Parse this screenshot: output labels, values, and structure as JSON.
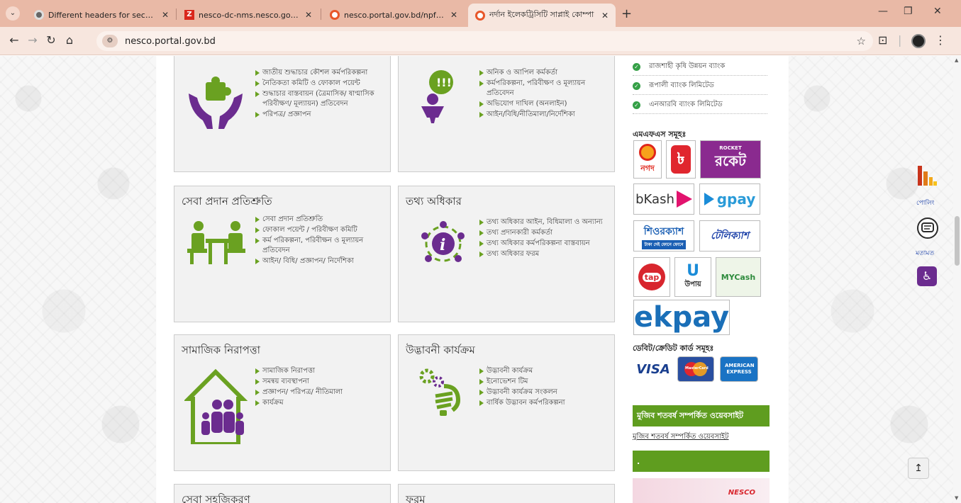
{
  "browser": {
    "tabs": [
      {
        "title": "Different headers for sections",
        "icon": "gear-favicon"
      },
      {
        "title": "nesco-dc-nms.nesco.gov.bd: H",
        "icon": "z-favicon"
      },
      {
        "title": "nesco.portal.gov.bd/npfadmin/",
        "icon": "portal-favicon"
      },
      {
        "title": "নর্দান ইলেকট্রিসিটি সাপ্লাই কোম্পা",
        "icon": "portal-favicon"
      }
    ],
    "url": "nesco.portal.gov.bd"
  },
  "cards": [
    {
      "title": "",
      "icon": "hands-puzzle-icon",
      "items": [
        "জাতীয় শুদ্ধাচার কৌশল কর্মপরিকল্পনা",
        "নৈতিকতা কমিটি ও ফোকাল পয়েন্ট",
        "শুদ্ধাচার বাস্তবায়ন (ত্রৈমাসিক/ ষাণ্মাসিক পরিবীক্ষণ/ মূল্যায়ন) প্রতিবেদন",
        "পরিপত্র/ প্রজ্ঞাপন"
      ]
    },
    {
      "title": "",
      "icon": "speech-person-icon",
      "items": [
        "অনিক ও আপিল কর্মকর্তা",
        "কর্মপরিকল্পনা, পরিবীক্ষণ ও মূল্যায়ন প্রতিবেদন",
        "অভিযোগ দাখিল (অনলাইন)",
        "আইন/বিধি/নীতিমালা/নির্দেশিকা"
      ]
    },
    {
      "title": "সেবা প্রদান প্রতিশ্রুতি",
      "icon": "service-desk-icon",
      "items": [
        "সেবা প্রদান প্রতিশ্রুতি",
        "ফোকাল পয়েন্ট / পরিবীক্ষণ কমিটি",
        "কর্ম পরিকল্পনা, পরিবীক্ষন ও মূল্যায়ন প্রতিবেদন",
        "আইন/ বিধি/ প্রজ্ঞাপন/ নির্দেশিকা"
      ]
    },
    {
      "title": "তথ্য অধিকার",
      "icon": "info-network-icon",
      "items": [
        "তথ্য অধিকার আইন, বিধিমালা ও অন্যান্য",
        "তথ্য প্রদানকারী কর্মকর্তা",
        "তথ্য অধিকার কর্মপরিকল্পনা বাস্তবায়ন",
        "তথ্য অধিকার ফরম"
      ]
    },
    {
      "title": "সামাজিক নিরাপত্তা",
      "icon": "family-house-icon",
      "items": [
        "সামাজিক নিরাপত্তা",
        "সমন্বয় ব্যবস্থাপনা",
        "প্রজ্ঞাপন/ পরিপত্র/ নীতিমালা",
        "কার্যক্রম"
      ]
    },
    {
      "title": "উদ্ভাবনী কার্যক্রম",
      "icon": "bulb-gears-icon",
      "items": [
        "উদ্ভাবনী কার্যক্রম",
        "ইনোভেশন টিম",
        "উদ্ভাবনী কার্যক্রম সংকলন",
        "বার্ষিক উদ্ভাবন কর্মপরিকল্পনা"
      ]
    },
    {
      "title": "সেবা সহজিকরণ",
      "icon": "",
      "items": []
    },
    {
      "title": "ফরম",
      "icon": "",
      "items": []
    }
  ],
  "sidebar": {
    "banks": [
      "রাজশাহী কৃষি উন্নয়ন ব্যাংক",
      "রূপালী ব্যাংক লিমিটেড",
      "এনআরবি ব্যাংক লিমিটেড"
    ],
    "mfs_heading": "এমএফএস সমূহঃ",
    "mfs_logos": {
      "nagad": "নগদ",
      "rocket": "রকেট",
      "rocket_small": "ROCKET",
      "bkash": "bKash",
      "gpay": "gpay",
      "surecash": "শিওরক্যাশ",
      "surecash_sub": "টাকা দেই ফোনে ফোনে",
      "telecash": "টেলিক্যাশ",
      "tap": "tap",
      "upay": "উপায়",
      "mycash": "MYCash",
      "ekpay": "ekpay"
    },
    "card_heading": "ডেবিট/ক্রেডিট কার্ড সমূহঃ",
    "card_logos": {
      "visa": "VISA",
      "mastercard": "MasterCard",
      "amex": "AMERICAN EXPRESS"
    },
    "mujib_band": "মুজিব শতবর্ষ সম্পর্কিত ওয়েবসাইট",
    "mujib_link": "মুজিব শতবর্ষ সম্পর্কিত ওয়েবসাইট",
    "second_band": ".",
    "nesco_banner": "NESCO"
  },
  "floating": {
    "poll_label": "পোলিং",
    "feedback_label": "মতামত"
  }
}
